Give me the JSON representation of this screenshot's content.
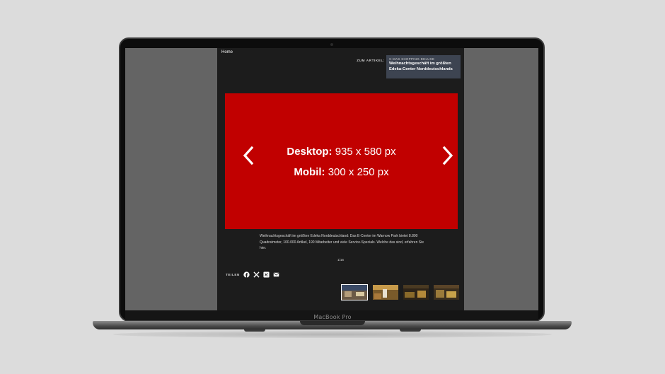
{
  "device": {
    "label": "MacBook Pro"
  },
  "site": {
    "home_link": "Home",
    "zum_artikel_label": "ZUM ARTIKEL:",
    "article": {
      "kicker": "X-MAS SHOPPING DELUXE",
      "title": "Weihnachtsgeschäft im größten Edeka-Center Norddeutschlands"
    },
    "ad": {
      "desktop_label": "Desktop:",
      "desktop_size": "935 x 580 px",
      "mobile_label": "Mobil:",
      "mobile_size": "300 x 250 px",
      "background_color": "#c10000"
    },
    "gallery": {
      "caption": "Weihnachtsgeschäft im größten Edeka Norddeutschland: Das E-Center im Warnow Park bietet 8.800 Quadratmeter, 100.000 Artikel, 190 Mitarbeiter und viele Service-Specials. Welche das sind, erfahren Sie hier.",
      "counter": "1/16",
      "prev_icon": "chevron-left-icon",
      "next_icon": "chevron-right-icon",
      "thumbnails": [
        {
          "name": "thumbnail-1",
          "active": true
        },
        {
          "name": "thumbnail-2",
          "active": false
        },
        {
          "name": "thumbnail-3",
          "active": false
        },
        {
          "name": "thumbnail-4",
          "active": false
        }
      ]
    },
    "share": {
      "label": "TEILEN",
      "icons": [
        "facebook-icon",
        "x-icon",
        "xing-icon",
        "mail-icon"
      ]
    }
  }
}
